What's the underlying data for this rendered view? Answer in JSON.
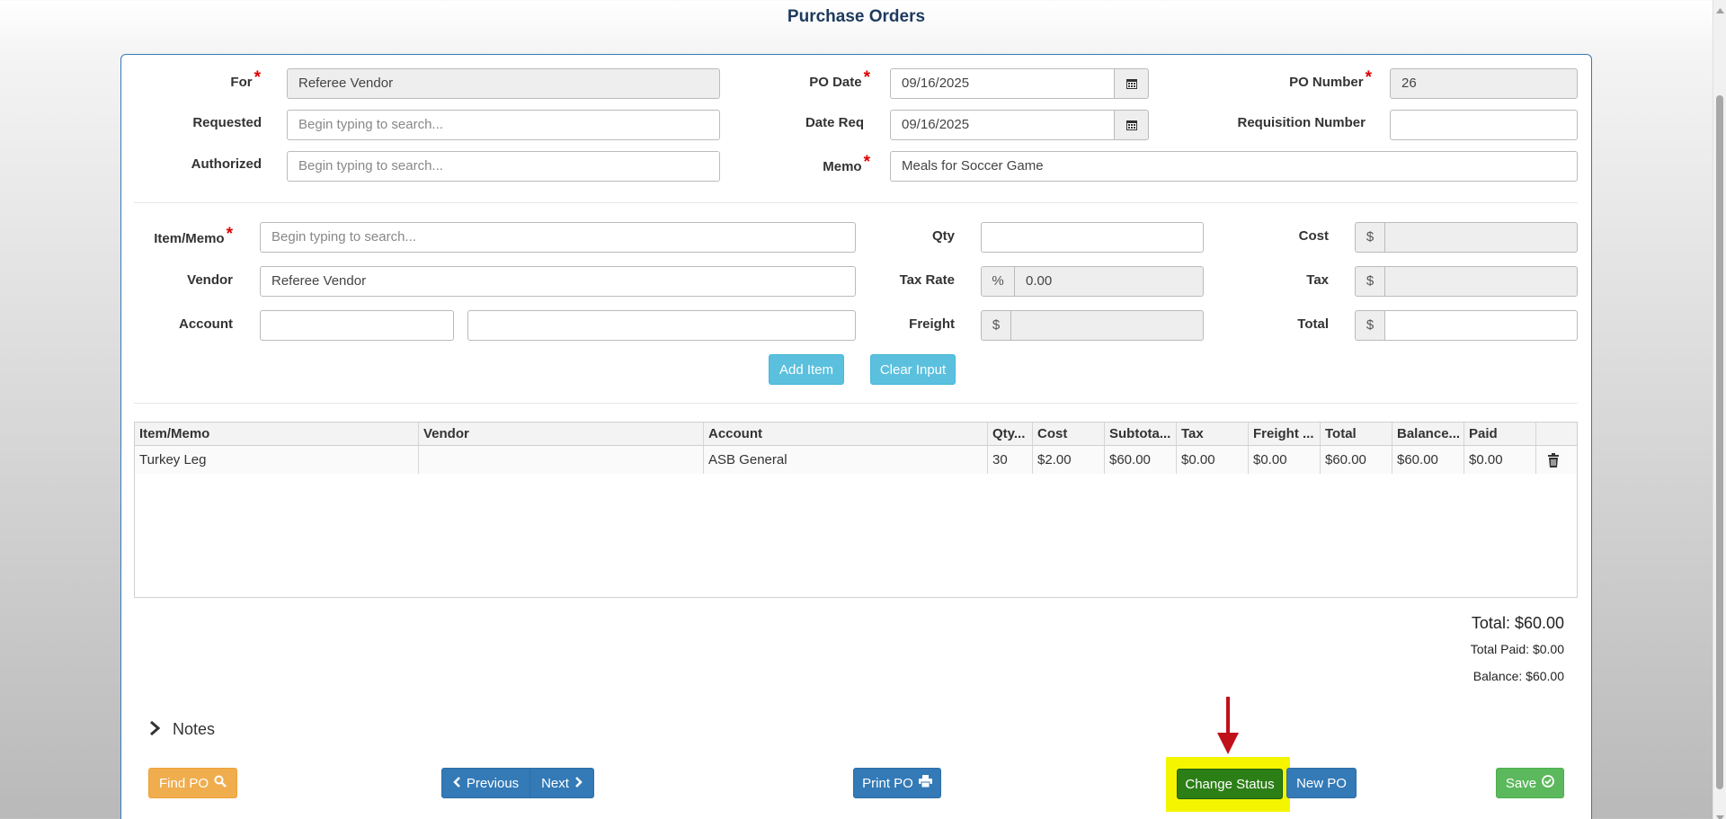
{
  "page": {
    "title": "Purchase Orders"
  },
  "header_form": {
    "for_label": "For",
    "for_value": "Referee Vendor",
    "requested_label": "Requested",
    "requested_placeholder": "Begin typing to search...",
    "authorized_label": "Authorized",
    "authorized_placeholder": "Begin typing to search...",
    "po_date_label": "PO Date",
    "po_date_value": "09/16/2025",
    "date_req_label": "Date Req",
    "date_req_value": "09/16/2025",
    "memo_label": "Memo",
    "memo_value": "Meals for Soccer Game",
    "po_number_label": "PO Number",
    "po_number_value": "26",
    "requisition_label": "Requisition Number",
    "requisition_value": ""
  },
  "item_form": {
    "item_label": "Item/Memo",
    "item_placeholder": "Begin typing to search...",
    "vendor_label": "Vendor",
    "vendor_value": "Referee Vendor",
    "account_label": "Account",
    "account_code": "",
    "account_name": "",
    "qty_label": "Qty",
    "qty_value": "",
    "tax_rate_label": "Tax Rate",
    "tax_rate_addon": "%",
    "tax_rate_value": "0.00",
    "freight_label": "Freight",
    "currency_addon": "$",
    "freight_value": "",
    "cost_label": "Cost",
    "cost_value": "",
    "tax_label": "Tax",
    "tax_value": "",
    "total_label": "Total",
    "total_value": "",
    "add_item_button": "Add Item",
    "clear_input_button": "Clear Input"
  },
  "grid": {
    "columns": [
      "Item/Memo",
      "Vendor",
      "Account",
      "Qty...",
      "Cost",
      "Subtota...",
      "Tax",
      "Freight ...",
      "Total",
      "Balance...",
      "Paid",
      ""
    ],
    "rows": [
      [
        "Turkey Leg",
        "",
        "ASB General",
        "30",
        "$2.00",
        "$60.00",
        "$0.00",
        "$0.00",
        "$60.00",
        "$60.00",
        "$0.00",
        "trash-icon"
      ]
    ]
  },
  "summary": {
    "total": "Total: $60.00",
    "total_paid": "Total Paid: $0.00",
    "balance": "Balance: $60.00"
  },
  "notes": {
    "label": "Notes"
  },
  "actions": {
    "find_po": "Find PO",
    "previous": "Previous",
    "next": "Next",
    "print_po": "Print PO",
    "change_status": "Change Status",
    "new_po": "New PO",
    "save": "Save"
  },
  "colors": {
    "primary": "#337ab7",
    "info": "#5bc0de",
    "warning": "#f0ad4e",
    "success": "#5cb85c",
    "highlight": "#f5f500",
    "annotation_arrow": "#c0101a",
    "required_star": "#dd0000"
  }
}
